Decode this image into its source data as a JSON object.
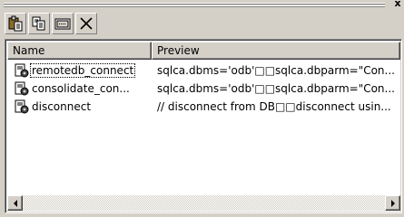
{
  "window": {
    "close_glyph": "x"
  },
  "toolbar": {
    "buttons": [
      {
        "icon": "paste-icon"
      },
      {
        "icon": "copy-icon"
      },
      {
        "icon": "view-icon"
      },
      {
        "icon": "delete-icon"
      }
    ]
  },
  "list": {
    "columns": {
      "name": "Name",
      "preview": "Preview"
    },
    "rows": [
      {
        "name": "remotedb_connect",
        "preview": "sqlca.dbms='odb'□□sqlca.dbparm=\"Con...",
        "selected": true
      },
      {
        "name": "consolidate_con...",
        "preview": "sqlca.dbms='odb'□□sqlca.dbparm=\"Con...",
        "selected": false
      },
      {
        "name": "disconnect",
        "preview": "// disconnect from DB□□disconnect usin...",
        "selected": false
      }
    ]
  },
  "colors": {
    "face": "#d4d0c8",
    "list_bg": "#ffffff"
  }
}
